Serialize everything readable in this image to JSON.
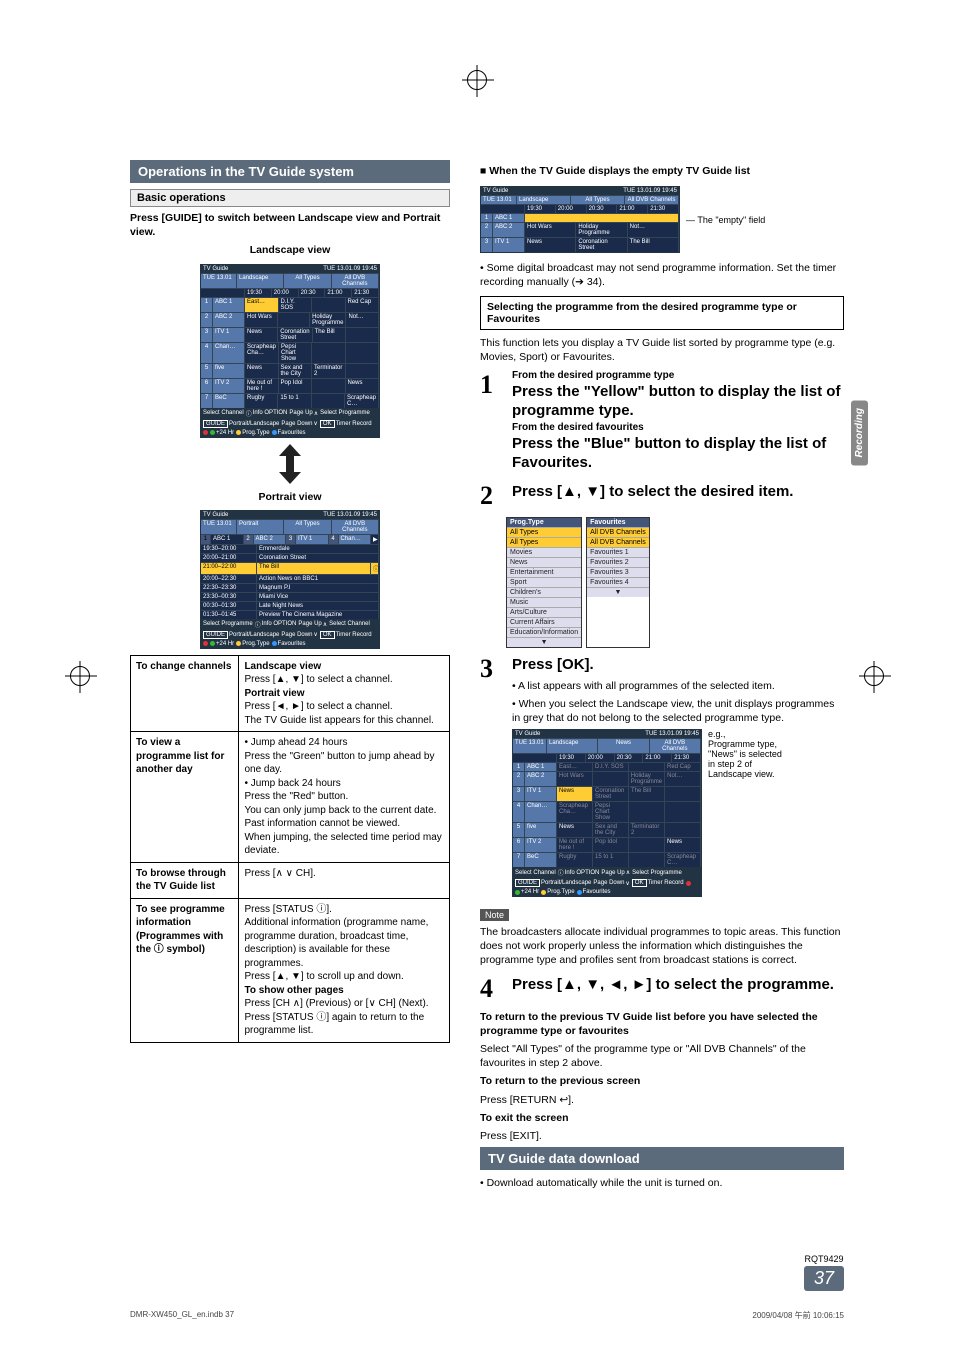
{
  "registration_marks": true,
  "side_tab": "Recording",
  "left": {
    "title_bar": "Operations in the TV Guide system",
    "sub_bar": "Basic operations",
    "intro": "Press [GUIDE] to switch between Landscape view and Portrait view.",
    "landscape_label": "Landscape view",
    "portrait_label": "Portrait view",
    "tvguide_common": {
      "title": "TV Guide",
      "timestamp": "TUE 13.01.09 19:45",
      "timer_label": "TUE 13.01",
      "alltypes": "All Types",
      "alldvb": "All DVB Channels",
      "footer_keys": {
        "select_channel": "Select Channel",
        "info_option": "Info    OPTION",
        "timer_rec": "Timer Record",
        "select_programme": "Select Programme",
        "portrait_landscape": "Portrait/Landscape",
        "page_up": "Page Up",
        "page_down": "Page Down",
        "plus24": "+24 Hr",
        "prog_type": "Prog.Type",
        "favourites": "Favourites"
      }
    },
    "landscape_guide": {
      "mode": "Landscape",
      "time_slots": [
        "19:30",
        "20:00",
        "20:30",
        "21:00",
        "21:30"
      ],
      "rows": [
        {
          "n": "1",
          "ch": "ABC 1",
          "cells": [
            "East…",
            "D.I.Y. SOS",
            "",
            "Red Cap"
          ]
        },
        {
          "n": "2",
          "ch": "ABC 2",
          "cells": [
            "Hot Wars",
            "",
            "Holiday Programme",
            "Not…"
          ]
        },
        {
          "n": "3",
          "ch": "ITV 1",
          "cells": [
            "News",
            "Coronation Street",
            "The Bill",
            ""
          ]
        },
        {
          "n": "4",
          "ch": "Chan…",
          "cells": [
            "Scrapheap Cha…",
            "Pepsi Chart Show",
            "",
            ""
          ]
        },
        {
          "n": "5",
          "ch": "five",
          "cells": [
            "News",
            "Sex and the City",
            "Terminator 2",
            ""
          ]
        },
        {
          "n": "6",
          "ch": "ITV 2",
          "cells": [
            "Me out of here !",
            "Pop Idol",
            "",
            "News"
          ]
        },
        {
          "n": "7",
          "ch": "BeC",
          "cells": [
            "Rugby",
            "15 to 1",
            "",
            "Scrapheap C…"
          ]
        }
      ]
    },
    "portrait_guide": {
      "mode": "Portrait",
      "channels_row": [
        {
          "n": "1",
          "ch": "ABC 1"
        },
        {
          "n": "2",
          "ch": "ABC 2"
        },
        {
          "n": "3",
          "ch": "ITV 1"
        },
        {
          "n": "4",
          "ch": "Chan…"
        }
      ],
      "items": [
        {
          "time": "19:30–20:00",
          "title": "Emmerdale"
        },
        {
          "time": "20:00–21:00",
          "title": "Coronation Street"
        },
        {
          "time": "21:00–22:00",
          "title": "The Bill",
          "selected": true
        },
        {
          "time": "20:00–22:30",
          "title": "Action News on BBC1"
        },
        {
          "time": "22:30–23:30",
          "title": "Magnum P.I"
        },
        {
          "time": "23:30–00:30",
          "title": "Miami Vice"
        },
        {
          "time": "00:30–01:30",
          "title": "Late Night News"
        },
        {
          "time": "01:30–01:45",
          "title": "Preview    The Cinema Magazine"
        }
      ]
    },
    "table": [
      {
        "label": "To change channels",
        "lines": [
          {
            "t": "Landscape view",
            "b": true
          },
          {
            "t": "Press [▲, ▼] to select a channel."
          },
          {
            "t": "Portrait view",
            "b": true
          },
          {
            "t": "Press [◄, ►] to select a channel."
          },
          {
            "t": "The TV Guide list appears for this channel."
          }
        ]
      },
      {
        "label": "To view a programme list for another day",
        "lines": [
          {
            "t": "• Jump ahead 24 hours"
          },
          {
            "t": "  Press the \"Green\" button to jump ahead by one day."
          },
          {
            "t": "• Jump back 24 hours"
          },
          {
            "t": "  Press the \"Red\" button."
          },
          {
            "t": "  You can only jump back to the current date. Past information cannot be viewed."
          },
          {
            "t": "When jumping, the selected time period may deviate."
          }
        ]
      },
      {
        "label": "To browse through the TV Guide list",
        "lines": [
          {
            "t": "Press [∧ ∨ CH]."
          }
        ]
      },
      {
        "label": "To see programme information\n(Programmes with the ⓘ symbol)",
        "lines": [
          {
            "t": "Press [STATUS ⓘ]."
          },
          {
            "t": "Additional information (programme name, programme duration, broadcast time, description) is available for these programmes."
          },
          {
            "t": "Press [▲, ▼] to scroll up and down."
          },
          {
            "t": "To show other pages",
            "b": true
          },
          {
            "t": "Press [CH ∧] (Previous) or [∨ CH] (Next)."
          },
          {
            "t": "Press [STATUS ⓘ] again to return to the programme list."
          }
        ]
      }
    ]
  },
  "right": {
    "empty_heading": "When the TV Guide displays the empty TV Guide list",
    "empty_label": "The \"empty\" field",
    "empty_note": "• Some digital broadcast may not send programme information. Set the timer recording manually (➔ 34).",
    "empty_guide_rows": [
      {
        "n": "1",
        "ch": "ABC 1"
      },
      {
        "n": "2",
        "ch": "ABC 2",
        "cells": [
          "Hot Wars",
          "Holiday Programme",
          "Not…"
        ]
      },
      {
        "n": "3",
        "ch": "ITV 1",
        "cells": [
          "News",
          "Coronation Street",
          "The Bill"
        ]
      }
    ],
    "boxed": "Selecting the programme from the desired programme type or Favourites",
    "boxed_sub": "This function lets you display a TV Guide list sorted by programme type (e.g. Movies, Sport) or Favourites.",
    "steps": [
      {
        "n": "1",
        "pre": "From the desired programme type",
        "head1": "Press the \"Yellow\" button to display the list of programme type.",
        "mid": "From the desired favourites",
        "head2": "Press the \"Blue\" button to display the list of Favourites."
      },
      {
        "n": "2",
        "head1": "Press [▲, ▼] to select the desired item."
      },
      {
        "n": "3",
        "head1": "Press [OK].",
        "body": [
          "• A list appears with all programmes of the selected item.",
          "• When you select the Landscape view, the unit displays programmes in grey that do not belong to the selected programme type."
        ],
        "caption": "e.g.,\nProgramme type, \"News\" is selected in step 2 of Landscape view."
      },
      {
        "n": "4",
        "head1": "Press [▲, ▼, ◄, ►] to select the programme."
      }
    ],
    "prog_type_col": {
      "header": "Prog.Type",
      "sel": "All Types",
      "items": [
        "All Types",
        "Movies",
        "News",
        "Entertainment",
        "Sport",
        "Children's",
        "Music",
        "Arts/Culture",
        "Current Affairs",
        "Education/Information"
      ]
    },
    "fav_col": {
      "header": "Favourites",
      "sel": "All DVB Channels",
      "items": [
        "All DVB Channels",
        "Favourites 1",
        "Favourites 2",
        "Favourites 3",
        "Favourites 4"
      ]
    },
    "news_guide": {
      "mode": "Landscape",
      "filter": "News",
      "rows": [
        {
          "n": "1",
          "ch": "ABC 1",
          "cells": [
            "East…",
            "D.I.Y. SOS",
            "",
            "Red Cap"
          ]
        },
        {
          "n": "2",
          "ch": "ABC 2",
          "cells": [
            "Hot Wars",
            "",
            "Holiday Programme",
            "Not…"
          ]
        },
        {
          "n": "3",
          "ch": "ITV 1",
          "cells": [
            "News",
            "Coronation Street",
            "The Bill",
            ""
          ]
        },
        {
          "n": "4",
          "ch": "Chan…",
          "cells": [
            "Scrapheap Cha…",
            "Pepsi Chart Show",
            "",
            ""
          ]
        },
        {
          "n": "5",
          "ch": "five",
          "cells": [
            "News",
            "Sex and the City",
            "Terminator 2",
            ""
          ]
        },
        {
          "n": "6",
          "ch": "ITV 2",
          "cells": [
            "Me out of here !",
            "Pop Idol",
            "",
            "News"
          ]
        },
        {
          "n": "7",
          "ch": "BeC",
          "cells": [
            "Rugby",
            "15 to 1",
            "",
            "Scrapheap C…"
          ]
        }
      ]
    },
    "note_label": "Note",
    "note_text": "The broadcasters allocate individual programmes to topic areas. This function does not work properly unless the information which distinguishes the programme type and profiles sent from broadcast stations is correct.",
    "return_block": {
      "h1": "To return to the previous TV Guide list before you have selected the programme type or favourites",
      "t1": "Select \"All Types\" of the programme type or \"All DVB Channels\" of the favourites in step 2 above.",
      "h2": "To return to the previous screen",
      "t2": "Press [RETURN ↩].",
      "h3": "To exit the screen",
      "t3": "Press [EXIT]."
    },
    "dl_bar": "TV Guide data download",
    "dl_text": "• Download automatically while the unit is turned on."
  },
  "page_code": "RQT9429",
  "page_num": "37",
  "footer_left": "DMR-XW450_GL_en.indb   37",
  "footer_right": "2009/04/08   午前 10:06:15"
}
